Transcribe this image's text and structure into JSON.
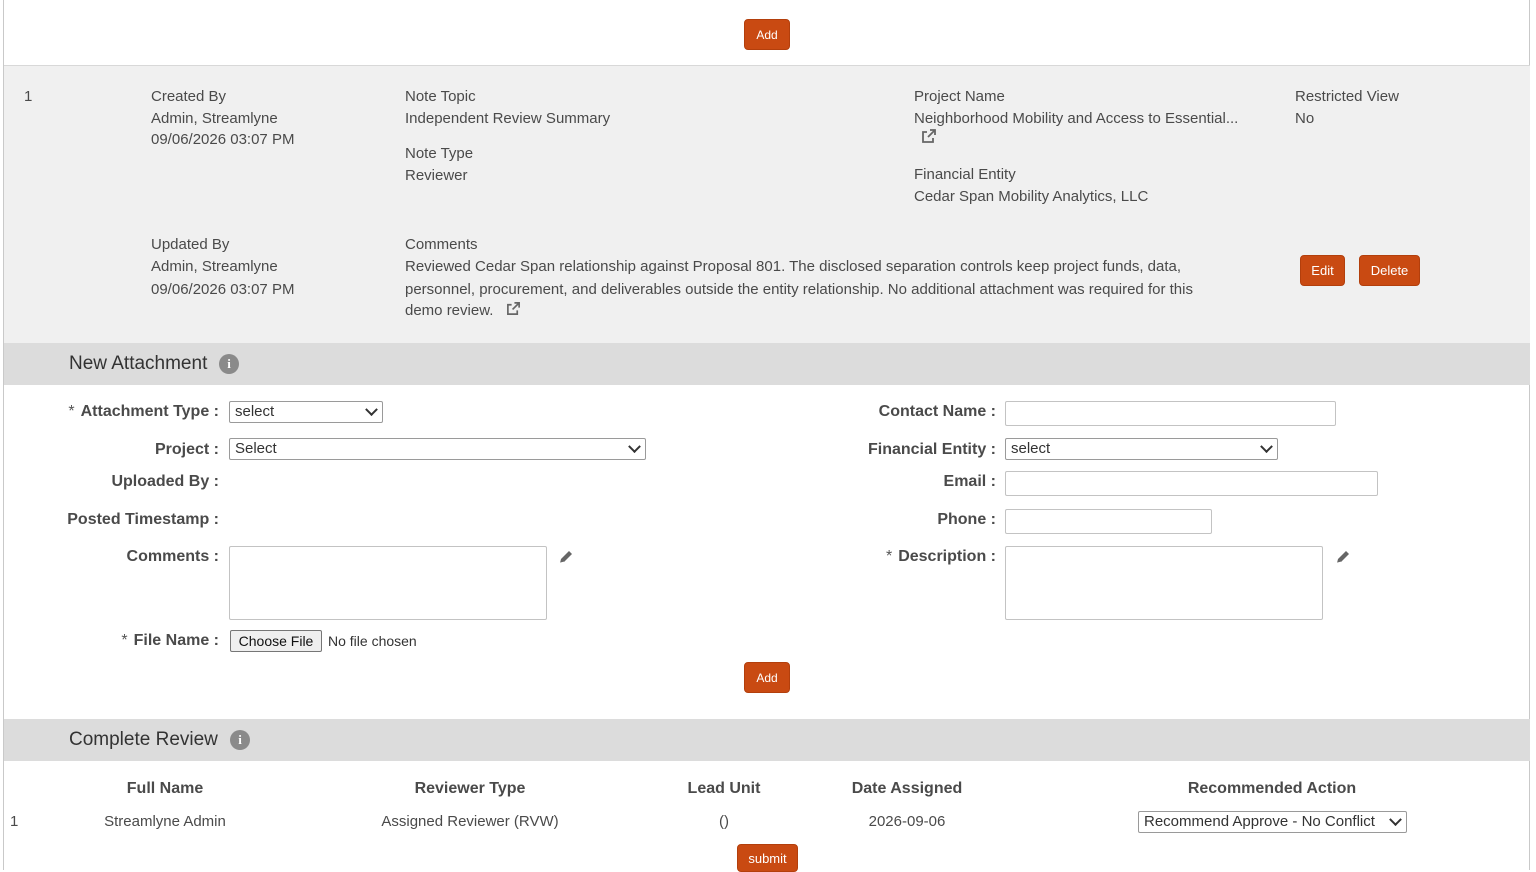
{
  "top": {
    "add_label": "Add"
  },
  "note": {
    "index": "1",
    "created_by_label": "Created By",
    "created_by_name": "Admin, Streamlyne",
    "created_by_time": "09/06/2026 03:07 PM",
    "note_topic_label": "Note Topic",
    "note_topic_value": "Independent Review Summary",
    "note_type_label": "Note Type",
    "note_type_value": "Reviewer",
    "project_name_label": "Project Name",
    "project_name_value": "Neighborhood Mobility and Access to Essential...",
    "financial_entity_label": "Financial Entity",
    "financial_entity_value": "Cedar Span Mobility Analytics, LLC",
    "restricted_view_label": "Restricted View",
    "restricted_view_value": "No",
    "updated_by_label": "Updated By",
    "updated_by_name": "Admin, Streamlyne",
    "updated_by_time": "09/06/2026 03:07 PM",
    "comments_label": "Comments",
    "comments_line1": "Reviewed Cedar Span relationship against Proposal 801. The disclosed separation controls keep project funds, data,",
    "comments_line2": "personnel, procurement, and deliverables outside the entity relationship. No additional attachment was required for this",
    "comments_line3": "demo review.",
    "edit_label": "Edit",
    "delete_label": "Delete"
  },
  "new_attachment": {
    "title": "New Attachment",
    "info_icon": "i",
    "required_mark": "*",
    "attachment_type_label": "Attachment Type :",
    "attachment_type_value": "select",
    "project_label": "Project :",
    "project_value": "Select",
    "uploaded_by_label": "Uploaded By :",
    "posted_timestamp_label": "Posted Timestamp :",
    "comments_label": "Comments :",
    "file_name_label": "File Name :",
    "choose_file_label": "Choose File",
    "no_file_text": "No file chosen",
    "contact_name_label": "Contact Name :",
    "financial_entity_label": "Financial Entity :",
    "financial_entity_value": "select",
    "email_label": "Email :",
    "phone_label": "Phone :",
    "description_label": "Description :",
    "add_label": "Add"
  },
  "complete_review": {
    "title": "Complete Review",
    "info_icon": "i",
    "columns": [
      "Full Name",
      "Reviewer Type",
      "Lead Unit",
      "Date Assigned",
      "Recommended Action"
    ],
    "rows": [
      {
        "index": "1",
        "full_name": "Streamlyne Admin",
        "reviewer_type": "Assigned Reviewer (RVW)",
        "lead_unit": "()",
        "date_assigned": "2026-09-06",
        "recommended_action": "Recommend Approve - No Conflict"
      }
    ],
    "submit_label": "submit"
  },
  "colors": {
    "accent": "#c94a12",
    "section_bar": "#dcdcdc",
    "note_bg": "#f0f0f0"
  },
  "icons": [
    "info-icon",
    "external-link-icon",
    "pencil-icon",
    "chevron-down-icon"
  ]
}
